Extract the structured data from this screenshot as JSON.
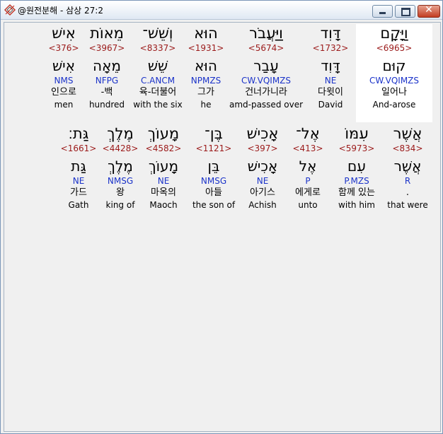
{
  "window": {
    "title": "@원전분해 - 삼상 27:2",
    "buttons": {
      "minimize": "minimize-icon",
      "maximize": "maximize-icon",
      "close": "✕"
    }
  },
  "verse": {
    "rows": [
      {
        "words": [
          {
            "hebrew": "וַיָּקָם",
            "strong": "<6965>",
            "root": "קוּם",
            "parse": "CW.VQIMZS",
            "korean": "일어나",
            "english": "And-arose",
            "highlighted": true
          },
          {
            "hebrew": "דָּוִד",
            "strong": "<1732>",
            "root": "דָּוִד",
            "parse": "NE",
            "korean": "다윗이",
            "english": "David"
          },
          {
            "hebrew": "וַיַּעֲבֹר",
            "strong": "<5674>",
            "root": "עָבַר",
            "parse": "CW.VQIMZS",
            "korean": "건너가니라",
            "english": "amd-passed over"
          },
          {
            "hebrew": "הוּא",
            "strong": "<1931>",
            "root": "הוּא",
            "parse": "NPMZS",
            "korean": "그가",
            "english": "he"
          },
          {
            "hebrew": "וְשֵׁשׁ־",
            "strong": "<8337>",
            "root": "שֵׁשׁ",
            "parse": "C.ANCM",
            "korean": "육-더불어",
            "english": "with the six"
          },
          {
            "hebrew": "מֵאוֹת",
            "strong": "<3967>",
            "root": "מֵאָה",
            "parse": "NFPG",
            "korean": "-백",
            "english": "hundred"
          },
          {
            "hebrew": "אִישׁ",
            "strong": "<376>",
            "root": "אִישׁ",
            "parse": "NMS",
            "korean": "인으로",
            "english": "men"
          }
        ]
      },
      {
        "words": [
          {
            "hebrew": "אֲשֶׁר",
            "strong": "<834>",
            "root": "אֲשֶׁר",
            "parse": "R",
            "korean": ".",
            "english": "that were"
          },
          {
            "hebrew": "עִמּוֹ",
            "strong": "<5973>",
            "root": "עִם",
            "parse": "P.MZS",
            "korean": "함께 있는",
            "english": "with him"
          },
          {
            "hebrew": "אֶל־",
            "strong": "<413>",
            "root": "אֶל",
            "parse": "P",
            "korean": "에게로",
            "english": "unto"
          },
          {
            "hebrew": "אָכִישׁ",
            "strong": "<397>",
            "root": "אָכִישׁ",
            "parse": "NE",
            "korean": "아기스",
            "english": "Achish"
          },
          {
            "hebrew": "בֶּן־",
            "strong": "<1121>",
            "root": "בֵּן",
            "parse": "NMSG",
            "korean": "아들",
            "english": "the son of"
          },
          {
            "hebrew": "מָעוֹךְ",
            "strong": "<4582>",
            "root": "מָעוֹךְ",
            "parse": "NE",
            "korean": "마옥의",
            "english": "Maoch"
          },
          {
            "hebrew": "מֶלֶךְ",
            "strong": "<4428>",
            "root": "מֶלֶךְ",
            "parse": "NMSG",
            "korean": "왕",
            "english": "king of"
          },
          {
            "hebrew": "גַּת׃",
            "strong": "<1661>",
            "root": "גַּת",
            "parse": "NE",
            "korean": "가드",
            "english": "Gath"
          }
        ]
      }
    ]
  },
  "colors": {
    "strong": "#9b1a1a",
    "parse": "#1b33c9",
    "highlight": "#ffffff",
    "background": "#f0f0f0"
  }
}
